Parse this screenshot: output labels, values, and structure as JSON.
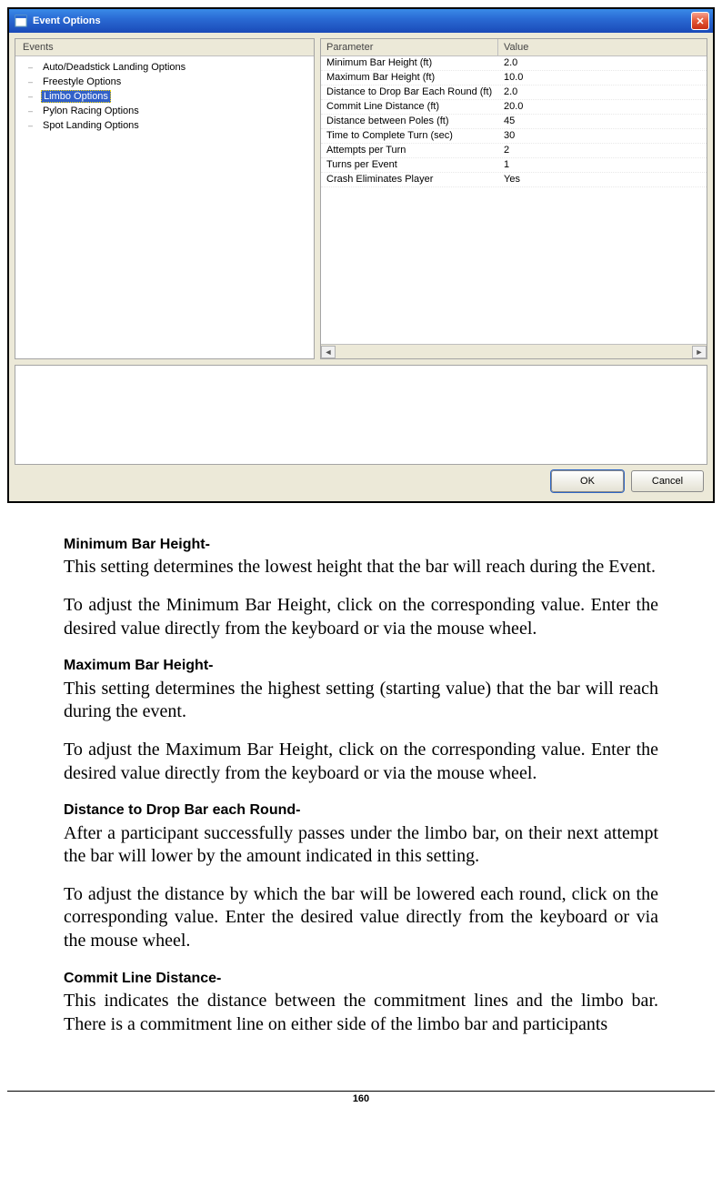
{
  "dialog": {
    "title": "Event Options",
    "closeGlyph": "✕",
    "tree": {
      "header": "Events",
      "items": [
        {
          "label": "Auto/Deadstick Landing Options",
          "selected": false
        },
        {
          "label": "Freestyle Options",
          "selected": false
        },
        {
          "label": "Limbo Options",
          "selected": true
        },
        {
          "label": "Pylon Racing Options",
          "selected": false
        },
        {
          "label": "Spot Landing Options",
          "selected": false
        }
      ]
    },
    "paramHeader": {
      "parameter": "Parameter",
      "value": "Value"
    },
    "params": [
      {
        "name": "Minimum Bar Height (ft)",
        "value": "2.0"
      },
      {
        "name": "Maximum Bar Height (ft)",
        "value": "10.0"
      },
      {
        "name": "Distance to Drop Bar Each Round (ft)",
        "value": "2.0"
      },
      {
        "name": "Commit Line Distance (ft)",
        "value": "20.0"
      },
      {
        "name": "Distance between Poles (ft)",
        "value": "45"
      },
      {
        "name": "Time to Complete Turn (sec)",
        "value": "30"
      },
      {
        "name": "Attempts per Turn",
        "value": "2"
      },
      {
        "name": "Turns per Event",
        "value": "1"
      },
      {
        "name": "Crash Eliminates Player",
        "value": "Yes"
      }
    ],
    "scroll": {
      "leftGlyph": "◄",
      "rightGlyph": "►"
    },
    "buttons": {
      "ok": "OK",
      "cancel": "Cancel"
    }
  },
  "doc": {
    "h1": "Minimum Bar Height-",
    "p1": "This setting determines the lowest height that the bar will reach during the Event.",
    "p2": "To adjust the Minimum Bar Height, click on the corresponding value.  Enter the desired value directly from the keyboard or via the mouse wheel.",
    "h2": "Maximum Bar Height-",
    "p3": "This setting determines the highest setting (starting value) that the bar will reach during the event.",
    "p4": "To adjust the Maximum Bar Height, click on the corresponding value.  Enter the desired value directly from the keyboard or via the mouse wheel.",
    "h3": "Distance to Drop Bar each Round-",
    "p5": "After a participant successfully passes under the limbo bar, on their next attempt the bar will lower by the amount indicated in this setting.",
    "p6": "To adjust the distance by which the bar will be lowered each round, click on the corresponding value.  Enter the desired value directly from the keyboard or via the mouse wheel.",
    "h4": "Commit Line Distance-",
    "p7": "This indicates the distance between the commitment lines and the limbo bar.  There is a commitment line on either side of the limbo bar and participants"
  },
  "pageNumber": "160"
}
